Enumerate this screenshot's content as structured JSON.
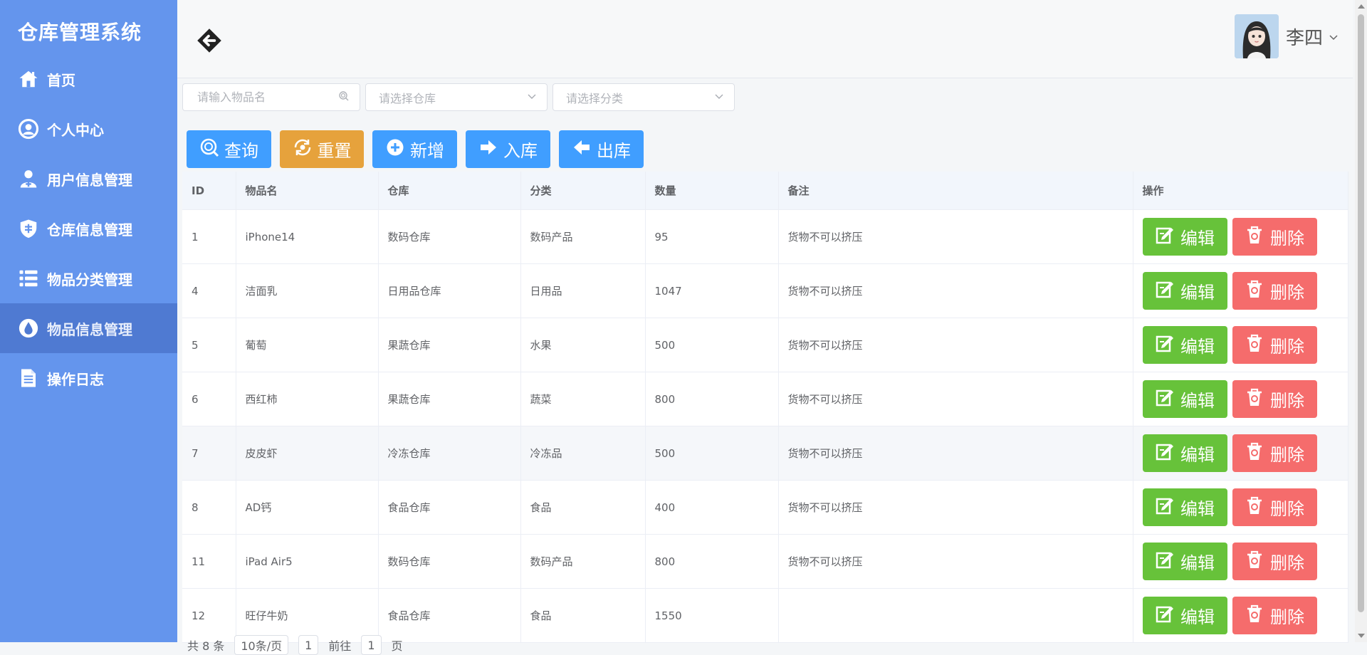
{
  "app": {
    "title": "仓库管理系统"
  },
  "sidebar": {
    "items": [
      {
        "label": "首页",
        "icon": "home-icon",
        "active": false
      },
      {
        "label": "个人中心",
        "icon": "user-circle-icon",
        "active": false
      },
      {
        "label": "用户信息管理",
        "icon": "user-add-icon",
        "active": false
      },
      {
        "label": "仓库信息管理",
        "icon": "shield-icon",
        "active": false
      },
      {
        "label": "物品分类管理",
        "icon": "list-icon",
        "active": false
      },
      {
        "label": "物品信息管理",
        "icon": "drop-icon",
        "active": true
      },
      {
        "label": "操作日志",
        "icon": "document-icon",
        "active": false
      }
    ]
  },
  "header": {
    "back_icon": "back-arrow-icon",
    "user_name": "李四"
  },
  "filters": {
    "name_placeholder": "请输入物品名",
    "warehouse_placeholder": "请选择仓库",
    "category_placeholder": "请选择分类"
  },
  "toolbar": {
    "query": "查询",
    "reset": "重置",
    "add": "新增",
    "inbound": "入库",
    "outbound": "出库"
  },
  "table": {
    "columns": [
      "ID",
      "物品名",
      "仓库",
      "分类",
      "数量",
      "备注",
      "操作"
    ],
    "rows": [
      {
        "id": "1",
        "name": "iPhone14",
        "warehouse": "数码仓库",
        "category": "数码产品",
        "qty": "95",
        "note": "货物不可以挤压"
      },
      {
        "id": "4",
        "name": "洁面乳",
        "warehouse": "日用品仓库",
        "category": "日用品",
        "qty": "1047",
        "note": "货物不可以挤压"
      },
      {
        "id": "5",
        "name": "葡萄",
        "warehouse": "果蔬仓库",
        "category": "水果",
        "qty": "500",
        "note": "货物不可以挤压"
      },
      {
        "id": "6",
        "name": "西红柿",
        "warehouse": "果蔬仓库",
        "category": "蔬菜",
        "qty": "800",
        "note": "货物不可以挤压"
      },
      {
        "id": "7",
        "name": "皮皮虾",
        "warehouse": "冷冻仓库",
        "category": "冷冻品",
        "qty": "500",
        "note": "货物不可以挤压"
      },
      {
        "id": "8",
        "name": "AD钙",
        "warehouse": "食品仓库",
        "category": "食品",
        "qty": "400",
        "note": "货物不可以挤压"
      },
      {
        "id": "11",
        "name": "iPad Air5",
        "warehouse": "数码仓库",
        "category": "数码产品",
        "qty": "800",
        "note": "货物不可以挤压"
      },
      {
        "id": "12",
        "name": "旺仔牛奶",
        "warehouse": "食品仓库",
        "category": "食品",
        "qty": "1550",
        "note": ""
      }
    ],
    "edit_label": "编辑",
    "delete_label": "删除"
  },
  "pager": {
    "total": "共 8 条",
    "page_size": "10条/页",
    "current": "1",
    "goto_prefix": "前往",
    "goto_value": "1",
    "goto_suffix": "页"
  },
  "colors": {
    "sidebar": "#6495ed",
    "primary": "#409eff",
    "warning": "#e6a23c",
    "success": "#67c23a",
    "danger": "#f56c6c"
  }
}
